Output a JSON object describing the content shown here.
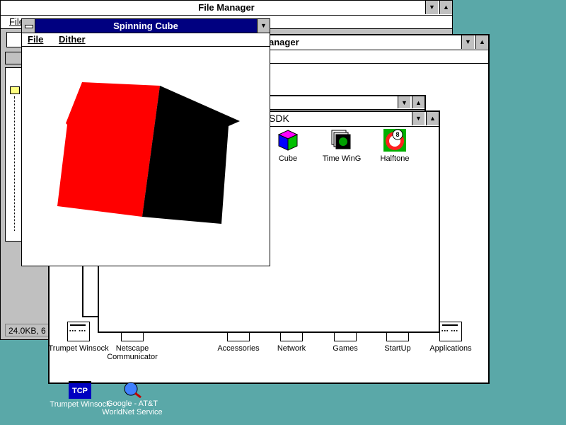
{
  "file_manager": {
    "title": "File Manager",
    "menu_first": "File",
    "status_text": "24.0KB, 6"
  },
  "program_manager": {
    "title_suffix": "anager"
  },
  "sdk_group": {
    "title_suffix": "SDK",
    "icons": [
      {
        "label": "Cube",
        "icon": "cube-icon"
      },
      {
        "label": "Time WinG",
        "icon": "time-wing-icon"
      },
      {
        "label": "Halftone",
        "icon": "halftone-icon"
      }
    ]
  },
  "program_groups": [
    {
      "label": "Trumpet Winsock"
    },
    {
      "label": "Netscape Communicator"
    },
    {
      "label": "Accessories"
    },
    {
      "label": "Network"
    },
    {
      "label": "Games"
    },
    {
      "label": "StartUp"
    },
    {
      "label": "Applications"
    }
  ],
  "spinning_cube": {
    "title": "Spinning Cube",
    "menu": [
      "File",
      "Dither"
    ],
    "face_colors": {
      "front": "#ff0000",
      "side": "#000000"
    }
  },
  "desktop_icons": [
    {
      "label": "Trumpet Winsock",
      "badge": "TCP"
    },
    {
      "label": "Google - AT&T WorldNet Service"
    }
  ],
  "colors": {
    "desktop": "#5aa8a8",
    "active_title": "#000080"
  }
}
